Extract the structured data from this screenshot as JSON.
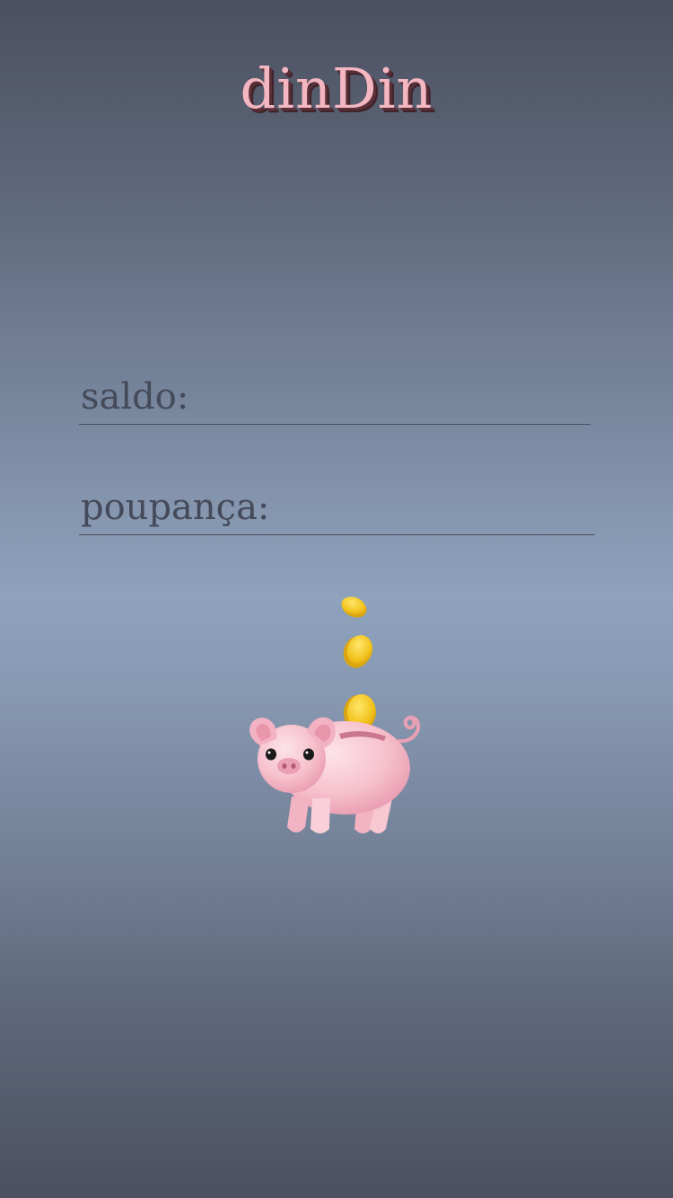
{
  "app": {
    "title": "dinDin"
  },
  "form": {
    "saldo": {
      "label": "saldo:",
      "value": "",
      "placeholder": ""
    },
    "poupanca": {
      "label": "poupança:",
      "value": "",
      "placeholder": ""
    }
  },
  "illustration": {
    "icon": "piggy-bank-with-coins-icon"
  },
  "colors": {
    "title_fill": "#f4b7c1",
    "title_shadow": "#5a2f38",
    "label_text": "#444a59",
    "underline": "#4a4f5e",
    "pig_pink": "#f6bfcb",
    "coin_gold": "#f2c21c"
  }
}
